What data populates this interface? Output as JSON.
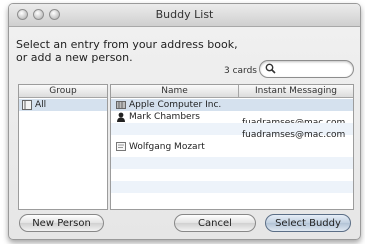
{
  "window": {
    "title": "Buddy List"
  },
  "instructions": {
    "line1": "Select an entry from your address book,",
    "line2": "or add a new person."
  },
  "search": {
    "count_label": "3 cards",
    "icon": "search-icon",
    "value": ""
  },
  "groups": {
    "header": "Group",
    "items": [
      {
        "label": "All",
        "icon": "group-card-icon"
      }
    ]
  },
  "people": {
    "headers": {
      "name": "Name",
      "im": "Instant Messaging"
    },
    "rows": [
      {
        "name": "Apple Computer Inc.",
        "icon": "company-icon",
        "im": ""
      },
      {
        "name": "Mark Chambers",
        "icon": "person-icon",
        "im": "fuadramses@mac.com"
      },
      {
        "name": "",
        "icon": "",
        "im": "fuadramses@mac.com"
      },
      {
        "name": "Wolfgang Mozart",
        "icon": "card-icon",
        "im": ""
      }
    ]
  },
  "buttons": {
    "new_person": "New Person",
    "cancel": "Cancel",
    "select_buddy": "Select Buddy"
  }
}
